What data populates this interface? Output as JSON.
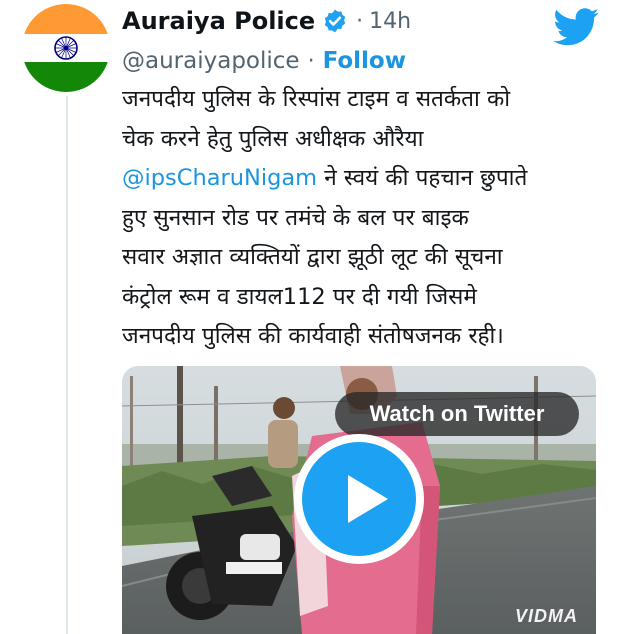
{
  "colors": {
    "link": "#1b95e0",
    "name": "#0f1419",
    "muted": "#536471",
    "twitter_blue": "#1da1f2",
    "verified": "#1da1f2"
  },
  "author": {
    "name": "Auraiya Police",
    "handle": "@auraiyapolice",
    "timestamp": "14h",
    "separator": "·",
    "follow_label": "Follow",
    "verified_icon": "verified-badge-icon",
    "avatar_icon": "indian-flag-avatar"
  },
  "brand_icon": "twitter-bird-icon",
  "tweet": {
    "line1": "जनपदीय पुलिस के रिस्पांस टाइम व सतर्कता को",
    "line2": "चेक करने हेतु पुलिस अधीक्षक औरैया",
    "mention": "@ipsCharuNigam",
    "line3_rest": " ने स्वयं की पहचान छुपाते",
    "line4": "हुए सुनसान रोड पर तमंचे के बल पर बाइक",
    "line5": "सवार अज्ञात व्यक्तियों द्वारा झूठी लूट की सूचना",
    "line6": "कंट्रोल रूम व डायल112 पर दी गयी जिसमे",
    "line7": "जनपदीय पुलिस की कार्यवाही संतोषजनक रही।"
  },
  "media": {
    "watch_label": "Watch on Twitter",
    "play_icon": "play-icon",
    "watermark": "VIDMA"
  }
}
